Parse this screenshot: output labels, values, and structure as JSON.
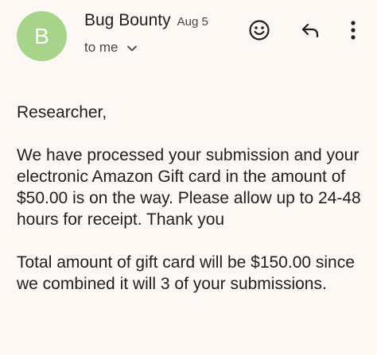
{
  "header": {
    "avatar_initial": "B",
    "sender_name": "Bug Bounty",
    "date": "Aug 5",
    "recipient_label": "to me",
    "icons": {
      "emoji": "emoji-reaction-icon",
      "reply": "reply-icon",
      "more": "more-vert-icon",
      "expand": "chevron-down-icon"
    }
  },
  "message": {
    "greeting": "Researcher,",
    "paragraph1": "We have processed your submission and your electronic Amazon Gift card in the amount of $50.00 is on the way. Please allow up to 24-48 hours for receipt. Thank you",
    "paragraph2": "Total amount of gift card will be $150.00 since we combined it will 3 of your submissions."
  },
  "colors": {
    "background": "#fdf8f4",
    "avatar": "#a8d38a",
    "text": "#1f1f1f",
    "secondary_text": "#444746"
  }
}
